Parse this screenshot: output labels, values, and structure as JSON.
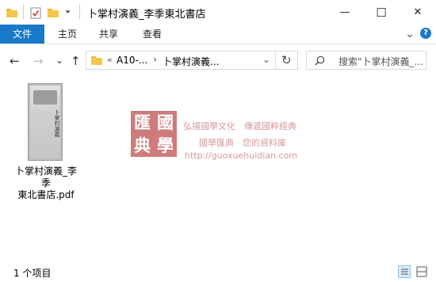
{
  "window": {
    "title": "卜掌村演義_李季東北書店",
    "minimize_glyph": "—",
    "maximize_glyph": "☐",
    "close_glyph": "✕"
  },
  "quick_access": {
    "icons": [
      "folder-icon",
      "properties-icon",
      "new-folder-icon",
      "customize-dropdown-icon"
    ],
    "dropdown_glyph": "⏷"
  },
  "ribbon": {
    "tabs": [
      "文件",
      "主页",
      "共享",
      "查看"
    ],
    "expand_glyph": "⌄",
    "help_glyph": "?"
  },
  "nav": {
    "back": "←",
    "forward": "→",
    "recent": "⌄",
    "up": "↑"
  },
  "address": {
    "overflow": "«",
    "segments": [
      "A10-...",
      "卜掌村演義..."
    ],
    "separator": "›",
    "dropdown": "⌄",
    "refresh": "↻"
  },
  "search": {
    "placeholder": "搜索\"卜掌村演義_..."
  },
  "files": [
    {
      "name": "卜掌村演義_李季東北書店.pdf",
      "name_line1": "卜掌村演義_李季",
      "name_line2": "東北書店.pdf",
      "thumb_title": "卜掌村演義"
    }
  ],
  "watermark": {
    "seal_chars": [
      "匯",
      "國",
      "典",
      "學"
    ],
    "line1": "弘揚國學文化　傳遞國粹經典",
    "line2": "國學匯典　您的資料庫",
    "url": "http://guoxuehuidian.com",
    "color": "#c05050"
  },
  "status": {
    "item_count": "1 个项目"
  },
  "colors": {
    "accent": "#1979ca",
    "folder": "#f4c64b"
  }
}
